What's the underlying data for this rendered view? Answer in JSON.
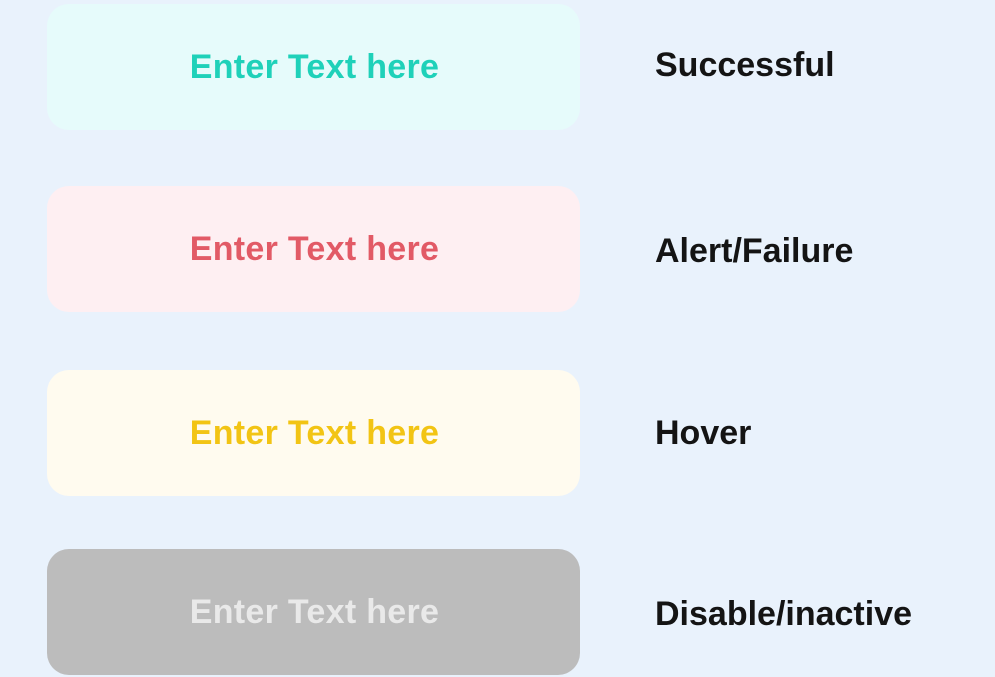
{
  "states": [
    {
      "id": "success",
      "placeholder": "Enter Text here",
      "label": "Successful",
      "bg_color": "#e6fbfb",
      "text_color": "#1fd1b9"
    },
    {
      "id": "alert",
      "placeholder": "Enter Text here",
      "label": "Alert/Failure",
      "bg_color": "#feeff2",
      "text_color": "#e25a66"
    },
    {
      "id": "hover",
      "placeholder": "Enter Text here",
      "label": "Hover",
      "bg_color": "#fffbef",
      "text_color": "#f2c414"
    },
    {
      "id": "disabled",
      "placeholder": "Enter Text here",
      "label": "Disable/inactive",
      "bg_color": "#bcbcbc",
      "text_color": "#e9e9e9"
    }
  ],
  "page": {
    "background": "#e9f2fc",
    "label_color": "#141414"
  }
}
